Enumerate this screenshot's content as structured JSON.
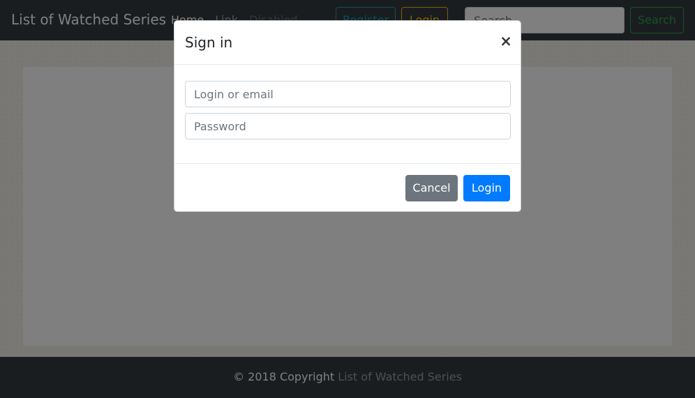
{
  "navbar": {
    "brand": "List of Watched Series",
    "links": [
      {
        "label": "Home",
        "state": "active"
      },
      {
        "label": "Link",
        "state": "normal"
      },
      {
        "label": "Disabled",
        "state": "disabled"
      }
    ],
    "register_label": "Register",
    "login_label": "Login",
    "search_placeholder": "Search",
    "search_button_label": "Search"
  },
  "footer": {
    "copyright": "© 2018 Copyright ",
    "link_text": "List of Watched Series"
  },
  "modal": {
    "title": "Sign in",
    "close_symbol": "×",
    "login_placeholder": "Login or email",
    "password_placeholder": "Password",
    "cancel_label": "Cancel",
    "login_label": "Login"
  },
  "colors": {
    "navbar_bg": "#343a40",
    "primary": "#007bff",
    "secondary": "#6c757d",
    "info": "#17a2b8",
    "warning": "#ffc107",
    "success": "#28a745"
  }
}
